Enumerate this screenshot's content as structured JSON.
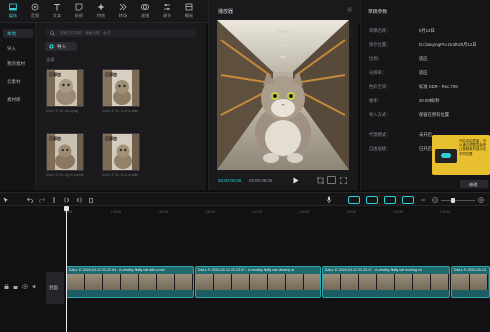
{
  "toolbar": {
    "items": [
      {
        "label": "媒体",
        "icon": "media-icon"
      },
      {
        "label": "音频",
        "icon": "audio-icon"
      },
      {
        "label": "文本",
        "icon": "text-icon"
      },
      {
        "label": "贴纸",
        "icon": "sticker-icon"
      },
      {
        "label": "特效",
        "icon": "effects-icon"
      },
      {
        "label": "转场",
        "icon": "transition-icon"
      },
      {
        "label": "滤镜",
        "icon": "filter-icon"
      },
      {
        "label": "调节",
        "icon": "adjust-icon"
      },
      {
        "label": "模板",
        "icon": "template-icon"
      }
    ]
  },
  "leftnav": {
    "items": [
      "本地",
      "导入",
      "我的素材",
      "云素材",
      "素材库"
    ]
  },
  "media": {
    "search_placeholder": "搜索文件名称、画面元素、台词",
    "import_label": "导入",
    "section_label": "全部",
    "thumbs": [
      {
        "badge": "已添加",
        "caption": "DALL·E 20...ed-splay"
      },
      {
        "badge": "已添加",
        "caption": "DALL·E 20...ly in a aisle"
      },
      {
        "badge": "已添加",
        "caption": "DALL·E 20...ng in a aisle"
      },
      {
        "badge": "已添加",
        "caption": "DALL·E 20...is in a aisle"
      }
    ]
  },
  "player": {
    "title": "播放器",
    "time_current": "00:00:00:00",
    "time_total": "00:00:39:26"
  },
  "props": {
    "title": "草稿参数",
    "rows": [
      {
        "k": "草稿名称：",
        "v": "0月12日"
      },
      {
        "k": "保存位置：",
        "v": "D:/JianyingPro Drafts/0月12日"
      },
      {
        "k": "比例：",
        "v": "适应"
      },
      {
        "k": "分辨率：",
        "v": "适应"
      },
      {
        "k": "色彩空间：",
        "v": "标准 SDR - Rec.709"
      },
      {
        "k": "帧率：",
        "v": "30.00帧/秒"
      },
      {
        "k": "导入方式：",
        "v": "保留在原有位置"
      },
      {
        "k": "代理模式：",
        "v": "未开启"
      },
      {
        "k": "自由层级：",
        "v": "已开启"
      }
    ],
    "tooltip": "开启自由层级，可以通过调整层级来让视频素材显示在不同位置",
    "modify_label": "修改"
  },
  "timeline": {
    "ruler": [
      "00:00",
      "| 00:05",
      "| 00:10",
      "| 00:15",
      "| 00:20",
      "| 00:25",
      "| 00:30",
      "| 00:35",
      "| 00:40"
    ],
    "cover_label": "封面",
    "clips": [
      "DALL·E 2024-03-12 22.22.54 - A chubby fluffy cat with a mix",
      "DALL·E 2024-03-12 22.23.07 - A chubby fluffy cat cleverly ar",
      "DALL·E 2024-03-12 22.23.17 - A chubby fluffy cat running co",
      "DALL·E 2024-03-13"
    ]
  },
  "colors": {
    "accent": "#2ecfd6",
    "track": "#1e6a6f",
    "tooltip": "#e8c02f"
  }
}
